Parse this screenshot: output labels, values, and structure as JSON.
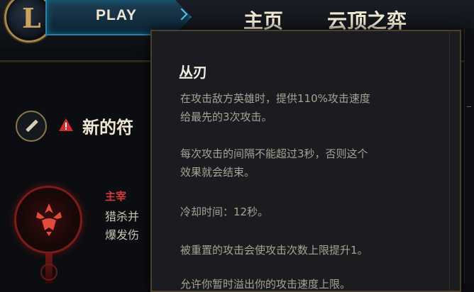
{
  "header": {
    "play_label": "PLAY",
    "nav": [
      "主页",
      "云顶之弈"
    ]
  },
  "rune_page": {
    "heading": "新的符",
    "primary_path": "主宰",
    "description": [
      "猎杀并",
      "爆发伤"
    ]
  },
  "tooltip": {
    "title": "丛刃",
    "lines": [
      "在攻击敌方英雄时，提供110%攻击速度",
      "给最先的3次攻击。",
      "",
      "每次攻击的间隔不能超过3秒，否则这个",
      "效果就会结束。",
      "",
      "冷却时间：12秒。",
      "",
      "被重置的攻击会使攻击次数上限提升1。",
      "",
      "允许你暂时溢出你的攻击速度上限。"
    ]
  },
  "colors": {
    "accent_gold": "#a9834a",
    "play_blue": "#2d7fa6",
    "domination_red": "#d33a3a",
    "warning_red": "#d22b2b"
  },
  "icons": [
    "league-logo-icon",
    "chevron-right-icon",
    "pencil-icon",
    "warning-icon",
    "domination-rune-icon"
  ]
}
